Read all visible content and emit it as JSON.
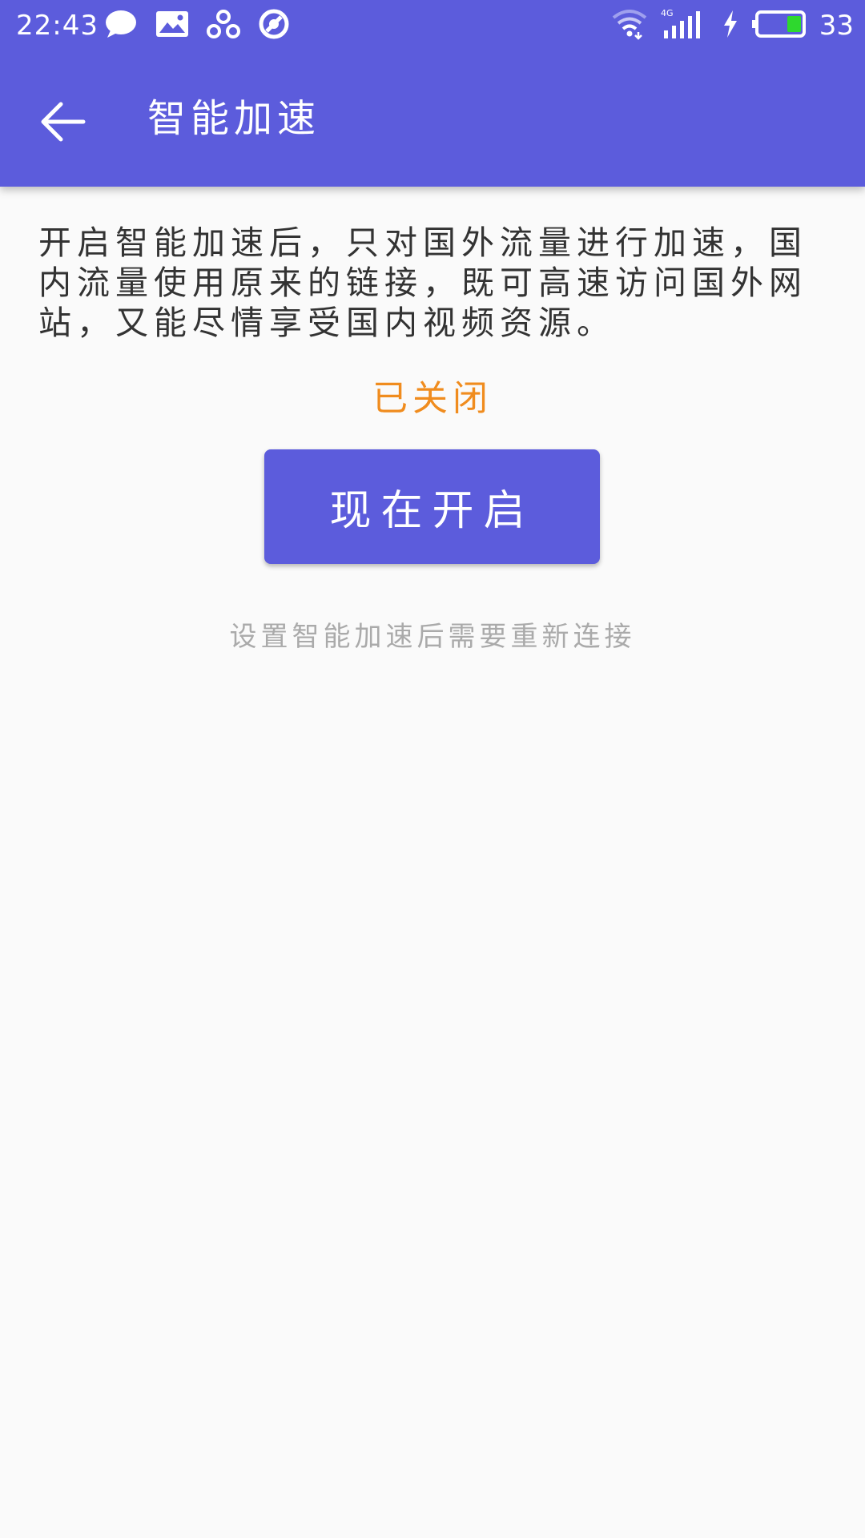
{
  "status_bar": {
    "time": "22:43",
    "battery_percent": "33",
    "network_type": "4G",
    "battery_level": 0.33,
    "icons": [
      "chat-bubble-icon",
      "image-icon",
      "app-link-icon",
      "blocked-icon",
      "wifi-icon",
      "signal-icon",
      "charging-icon",
      "battery-icon"
    ]
  },
  "toolbar": {
    "title": "智能加速"
  },
  "content": {
    "description": "开启智能加速后，只对国外流量进行加速，国内流量使用原来的链接，既可高速访问国外网站，又能尽情享受国内视频资源。",
    "status": "已关闭",
    "enable_button_label": "现在开启",
    "hint": "设置智能加速后需要重新连接"
  },
  "colors": {
    "primary": "#5c5cdc",
    "status_orange": "#f08c1e",
    "body_text": "#333333",
    "hint_text": "#aaaaaa",
    "background": "#fafafa"
  }
}
